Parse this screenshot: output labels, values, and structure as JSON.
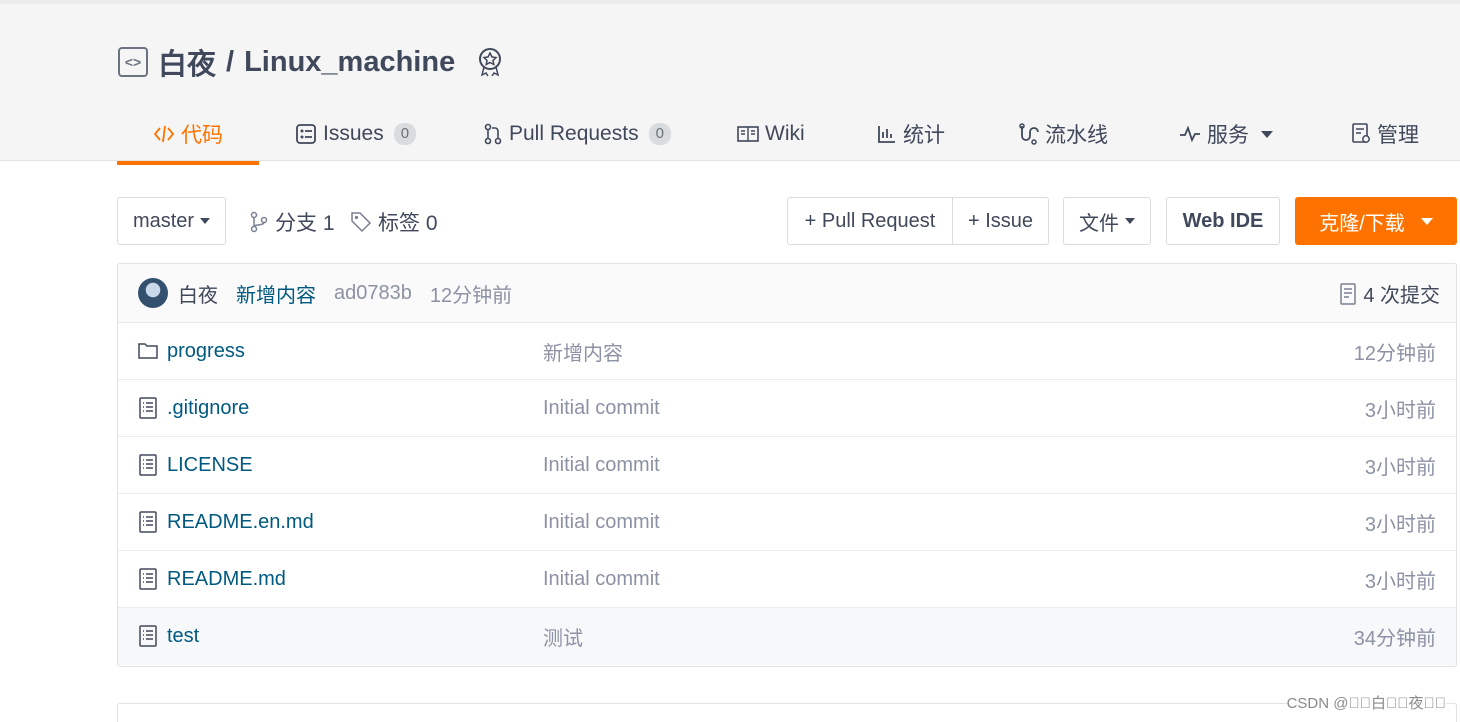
{
  "repo": {
    "owner": "白夜",
    "separator": "/",
    "name": "Linux_machine"
  },
  "tabs": [
    {
      "label": "代码",
      "icon": "code-icon"
    },
    {
      "label": "Issues",
      "count": "0",
      "icon": "issues-icon"
    },
    {
      "label": "Pull Requests",
      "count": "0",
      "icon": "pull-request-icon"
    },
    {
      "label": "Wiki",
      "icon": "book-icon"
    },
    {
      "label": "统计",
      "icon": "chart-icon"
    },
    {
      "label": "流水线",
      "icon": "pipeline-icon"
    },
    {
      "label": "服务",
      "icon": "pulse-icon"
    },
    {
      "label": "管理",
      "icon": "settings-doc-icon"
    }
  ],
  "toolbar": {
    "branch": "master",
    "branches_label": "分支 1",
    "tags_label": "标签 0",
    "pull_request_label": "+ Pull Request",
    "issue_label": "+ Issue",
    "file_label": "文件",
    "web_ide_label": "Web IDE",
    "clone_label": "克隆/下载"
  },
  "commit": {
    "author": "白夜",
    "message": "新增内容",
    "hash": "ad0783b",
    "time": "12分钟前",
    "count_label": "4 次提交"
  },
  "files": [
    {
      "name": "progress",
      "type": "folder",
      "message": "新增内容",
      "time": "12分钟前"
    },
    {
      "name": ".gitignore",
      "type": "file",
      "message": "Initial commit",
      "time": "3小时前"
    },
    {
      "name": "LICENSE",
      "type": "file",
      "message": "Initial commit",
      "time": "3小时前"
    },
    {
      "name": "README.en.md",
      "type": "file",
      "message": "Initial commit",
      "time": "3小时前"
    },
    {
      "name": "README.md",
      "type": "file",
      "message": "Initial commit",
      "time": "3小时前"
    },
    {
      "name": "test",
      "type": "file",
      "message": "测试",
      "time": "34分钟前"
    }
  ],
  "watermark": "CSDN @\u0000\u0000白\u0000\u0000夜\u0000\u0000",
  "colors": {
    "accent": "#fe7300",
    "link": "#005980",
    "muted": "#8c92a4"
  }
}
